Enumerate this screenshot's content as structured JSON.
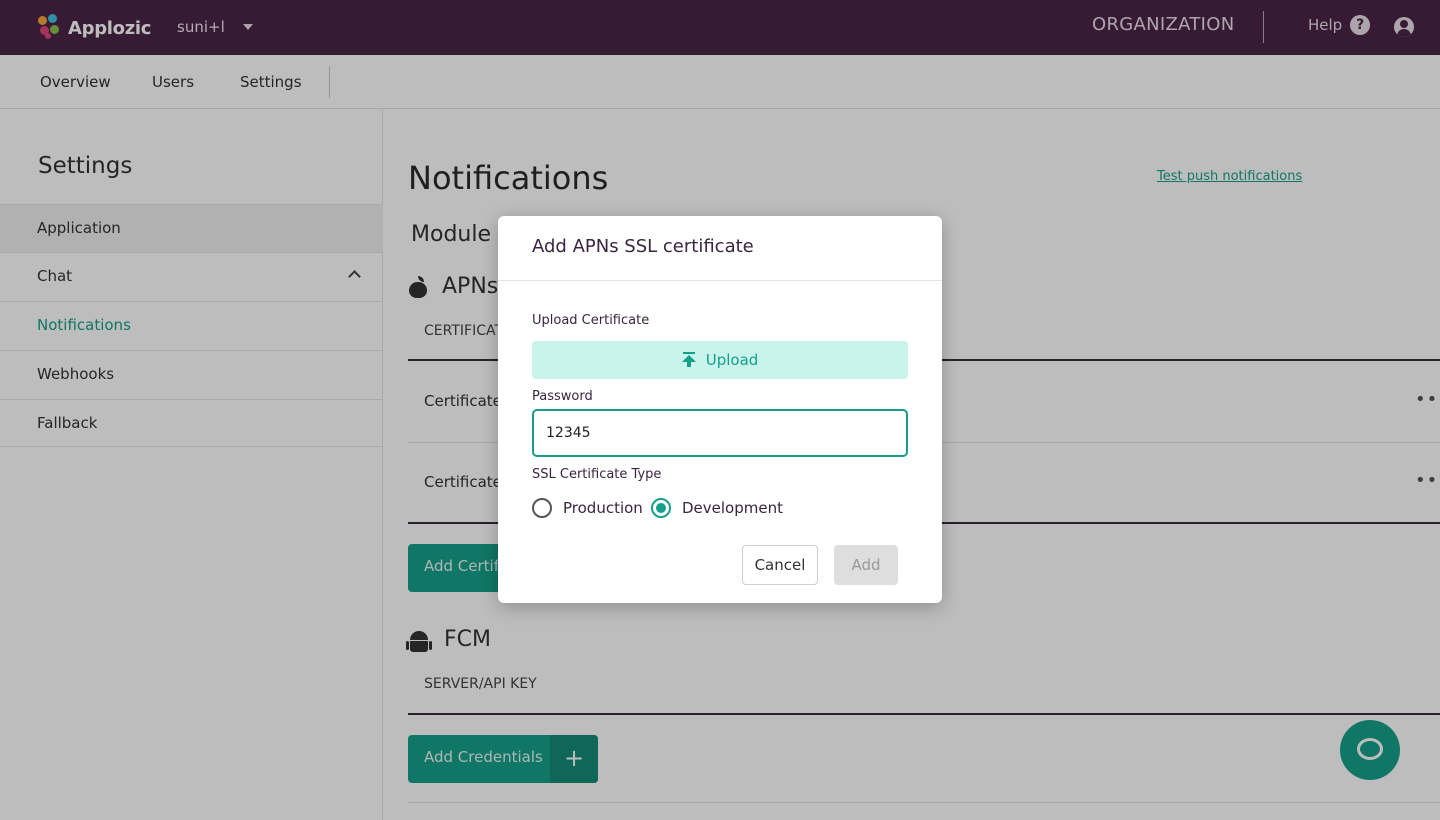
{
  "topbar": {
    "brand": "Applozic",
    "app_name": "suni+l",
    "organization": "ORGANIZATION",
    "help": "Help",
    "help_icon": "?"
  },
  "subnav": {
    "items": [
      "Overview",
      "Users",
      "Settings"
    ]
  },
  "sidebar": {
    "title": "Settings",
    "items": [
      "Application",
      "Chat",
      "Notifications",
      "Webhooks",
      "Fallback"
    ],
    "selected": "Notifications"
  },
  "main": {
    "title": "Notifications",
    "test_link": "Test push notifications",
    "module_title": "Module N",
    "apns": {
      "label": "APNs",
      "column_header": "CERTIFICAT",
      "rows": [
        "Certificate",
        "Certificate"
      ],
      "row_menu": "•••",
      "add_button": "Add Certifi"
    },
    "fcm": {
      "label": "FCM",
      "column_header": "SERVER/API KEY",
      "add_button": "Add Credentials",
      "add_button_plus": "+"
    }
  },
  "modal": {
    "title": "Add APNs SSL certificate",
    "upload_label": "Upload Certificate",
    "upload_button": "Upload",
    "password_label": "Password",
    "password_value": "12345",
    "type_label": "SSL Certificate Type",
    "options": [
      "Production",
      "Development"
    ],
    "selected_option": "Development",
    "cancel": "Cancel",
    "add": "Add"
  },
  "colors": {
    "topbar": "#4b2447",
    "accent": "#16a089",
    "upload_bg": "#c9f4ec"
  }
}
